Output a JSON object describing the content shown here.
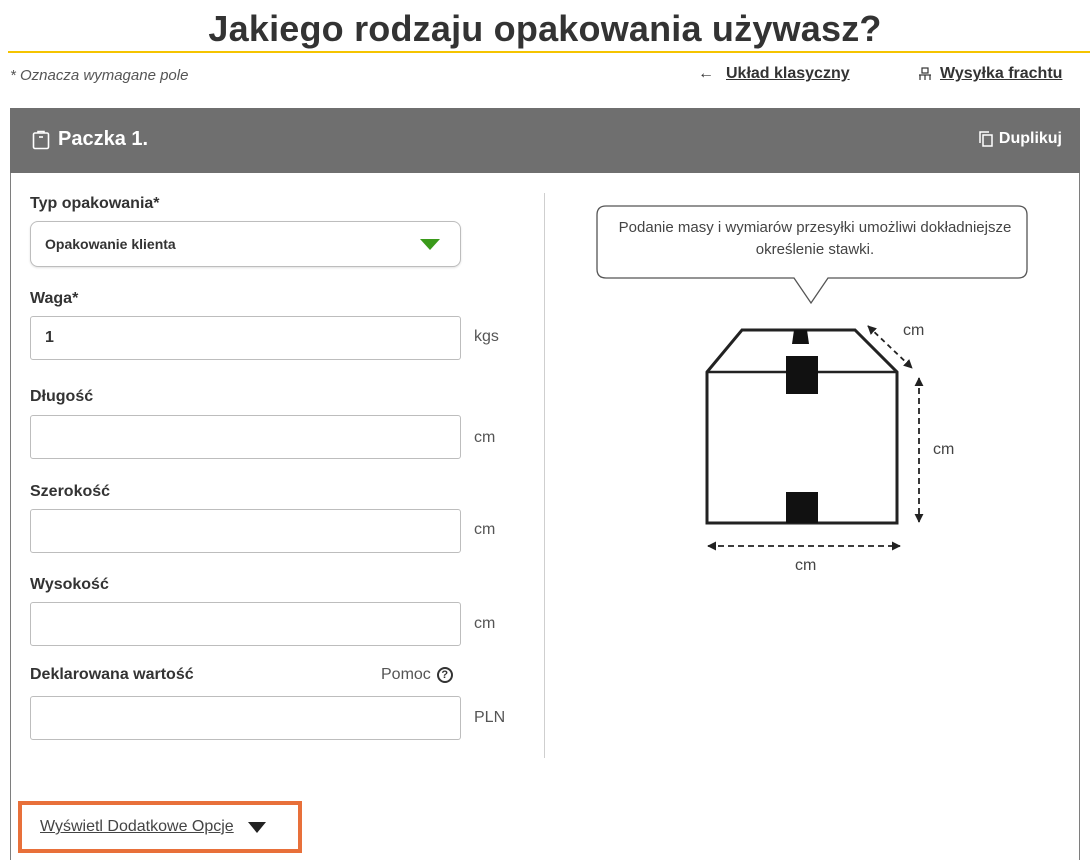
{
  "page": {
    "title": "Jakiego rodzaju opakowania używasz?",
    "required_note": "* Oznacza wymagane pole",
    "accent_color": "#f5c400"
  },
  "top_links": {
    "classic_layout": "Układ klasyczny",
    "freight_shipping": "Wysyłka frachtu"
  },
  "package": {
    "title": "Paczka 1.",
    "duplicate_label": "Duplikuj",
    "header_color": "#6f6f6f"
  },
  "form": {
    "package_type": {
      "label": "Typ opakowania*",
      "value": "Opakowanie klienta"
    },
    "weight": {
      "label": "Waga*",
      "value": "1",
      "unit": "kgs"
    },
    "length": {
      "label": "Długość",
      "value": "",
      "unit": "cm"
    },
    "width": {
      "label": "Szerokość",
      "value": "",
      "unit": "cm"
    },
    "height": {
      "label": "Wysokość",
      "value": "",
      "unit": "cm"
    },
    "declared_value": {
      "label": "Deklarowana wartość",
      "value": "",
      "unit": "PLN",
      "help_label": "Pomoc",
      "help_icon": "?"
    }
  },
  "illustration": {
    "tooltip_text": "Podanie masy i wymiarów przesyłki umożliwi dokładniejsze określenie stawki.",
    "depth_unit": "cm",
    "height_unit": "cm",
    "width_unit": "cm"
  },
  "more_options": {
    "label": "Wyświetl Dodatkowe Opcje",
    "highlight_color": "#e8703a"
  }
}
